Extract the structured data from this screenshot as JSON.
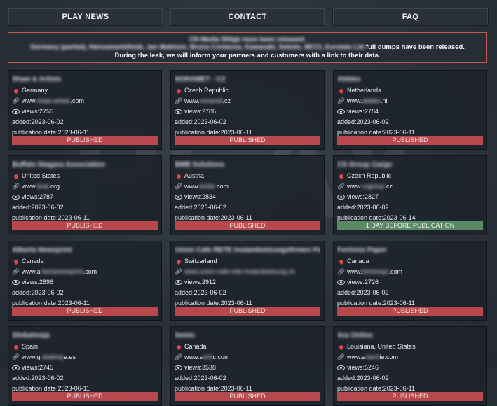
{
  "nav": [
    {
      "id": "play-news",
      "label": "PLAY NEWS"
    },
    {
      "id": "contact",
      "label": "CONTACT"
    },
    {
      "id": "faq",
      "label": "FAQ"
    }
  ],
  "notice": {
    "line1": "CN Media 500gb have been released.",
    "line2_blurred": "Germany (partial), Hansamarkt/kmb, Jan Makinen, Bruna Contessa, Kawasaki, Sekolo, MCCI, Eurotale Ltd",
    "line2_end": " full dumps have been released.",
    "line3": "During the leak, we will inform your partners and customers with a link to their data."
  },
  "watermark": "PLAY",
  "labels": {
    "views": "views: ",
    "added": "added: ",
    "pub": "publication date: "
  },
  "cards": [
    {
      "name": "Shaw & Artists",
      "country": "Germany",
      "url_pre": "www.",
      "url_blur": "shaw-artists",
      "url_post": ".com",
      "views": "2755",
      "added": "2023-06-02",
      "pub": "2023-06-11",
      "status": "PUBLISHED"
    },
    {
      "name": "NORAMET - CZ",
      "name_blur": true,
      "country": "Czech Republic",
      "url_pre": "www.",
      "url_blur": "noramet",
      "url_post": ".cz",
      "views": "2786",
      "added": "2023-06-02",
      "pub": "2023-06-11",
      "status": "PUBLISHED"
    },
    {
      "name": "Aldeko",
      "country": "Netherlands",
      "url_pre": "www.",
      "url_blur": "aldeko",
      "url_post": ".nl",
      "views": "2784",
      "added": "2023-06-02",
      "pub": "2023-06-11",
      "status": "PUBLISHED"
    },
    {
      "name": "Buffalo Niagara Association",
      "country": "United States",
      "url_pre": "www.",
      "url_blur": "bnai",
      "url_post": ".org",
      "views": "2787",
      "added": "2023-06-02",
      "pub": "2023-06-11",
      "status": "PUBLISHED"
    },
    {
      "name": "BMB Solutions",
      "country": "Austria",
      "url_pre": "www.",
      "url_blur": "bmbs",
      "url_post": ".com",
      "views": "2834",
      "added": "2023-06-02",
      "pub": "2023-06-11",
      "status": "PUBLISHED"
    },
    {
      "name": "CS Group Cargo",
      "country": "Czech Republic",
      "url_pre": "www.",
      "url_blur": "csgroup",
      "url_post": ".cz",
      "views": "2827",
      "added": "2023-06-02",
      "pub": "2023-06-14",
      "status": "1 DAY BEFORE PUBLICATION",
      "soon": true
    },
    {
      "name": "Alberta Newsprint",
      "country": "Canada",
      "url_pre": "www.al",
      "url_blur": "bertanewsprint",
      "url_post": ".com",
      "views": "2896",
      "added": "2023-06-02",
      "pub": "2023-06-11",
      "status": "PUBLISHED"
    },
    {
      "name": "Union Cafe RETE Instandsetzungsfirmen Politik S...",
      "country": "Switzerland",
      "url_pre": "",
      "url_blur": "www.union-cafe-rete-instandsetzung.ch",
      "url_post": "",
      "views": "2912",
      "added": "2023-06-02",
      "pub": "2023-06-11",
      "status": "PUBLISHED"
    },
    {
      "name": "Fortress Paper",
      "country": "Canada",
      "url_pre": "www.",
      "url_blur": "fortresspr",
      "url_post": ".com",
      "views": "2726",
      "added": "2023-06-02",
      "pub": "2023-06-11",
      "status": "PUBLISHED"
    },
    {
      "name": "Globalmeja",
      "country": "Spain",
      "url_pre": "www.gl",
      "url_blur": "obalmej",
      "url_post": "a.es",
      "views": "2745",
      "added": "2023-06-02",
      "pub": "2023-06-11",
      "status": "PUBLISHED"
    },
    {
      "name": "Semic",
      "country": "Canada",
      "url_pre": "www.s",
      "url_blur": "emi",
      "url_post": "c.com",
      "views": "3538",
      "added": "2023-06-02",
      "pub": "2023-06-11",
      "status": "PUBLISHED"
    },
    {
      "name": "Ara Online",
      "country": "Louisiana, United States",
      "url_pre": "www.a",
      "url_blur": "raonl",
      "url_post": "ie.com",
      "views": "5246",
      "added": "2023-06-02",
      "pub": "2023-06-11",
      "status": "PUBLISHED"
    }
  ]
}
